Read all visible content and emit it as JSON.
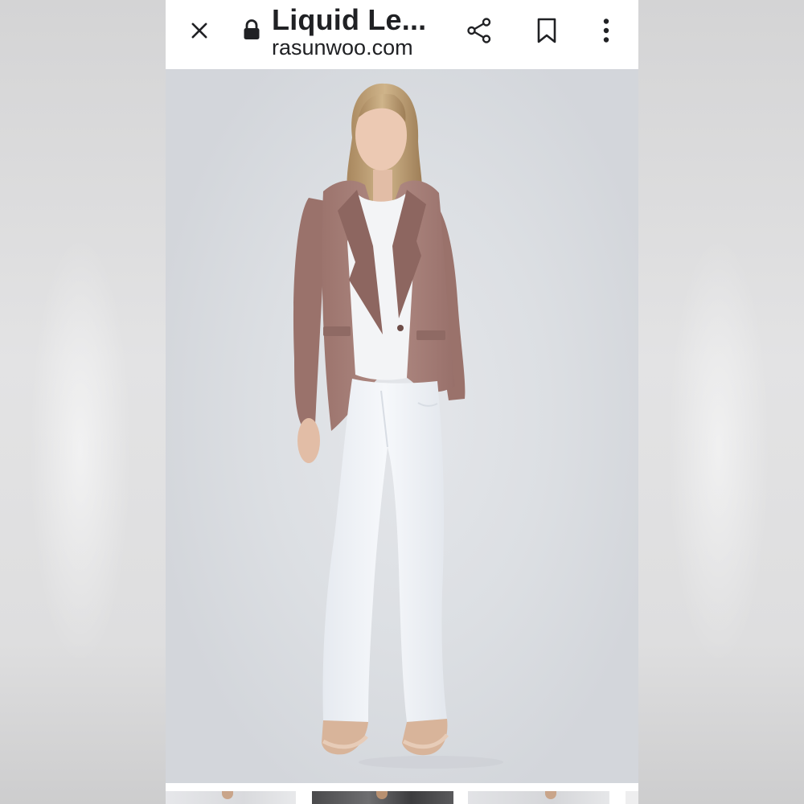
{
  "header": {
    "title": "Liquid Le...",
    "url": "rasunwoo.com",
    "icons": {
      "close": "close-icon",
      "lock": "lock-icon",
      "share": "share-icon",
      "bookmark": "bookmark-icon",
      "more": "more-vert-icon"
    }
  },
  "product_image": {
    "subject": "model wearing mauve leather blazer, white top and white trousers",
    "colors": {
      "blazer": "#a77f78",
      "top": "#f1f2f4",
      "pants": "#eef1f5",
      "background": "#dcdfe3"
    }
  },
  "thumbnails": {
    "count": 4
  },
  "theme": {
    "bar_background": "#ffffff",
    "text": "#202124"
  }
}
